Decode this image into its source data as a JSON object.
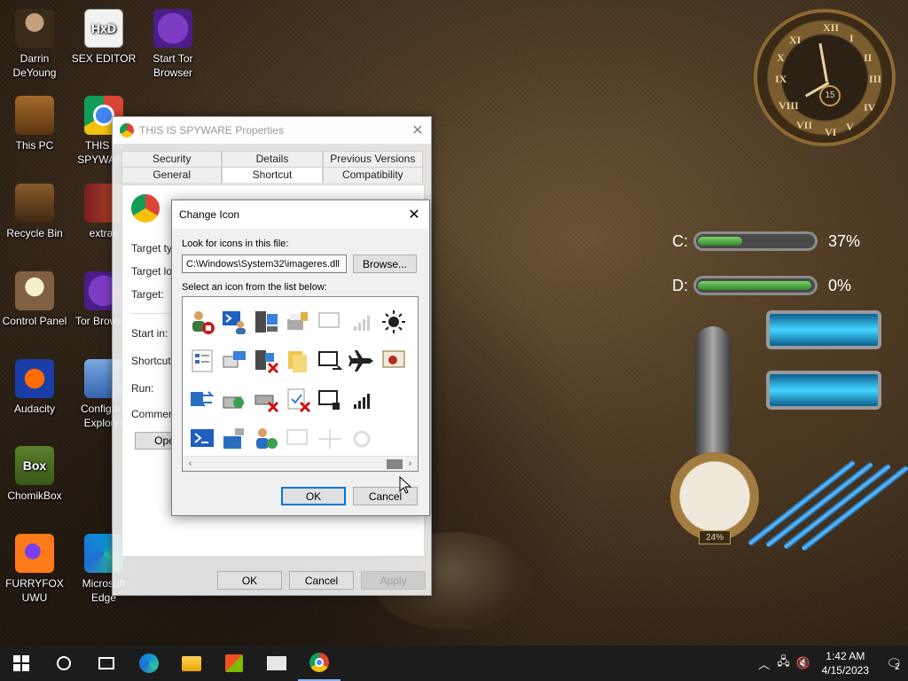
{
  "desktop": {
    "icons": [
      {
        "label": "Darrin DeYoung",
        "icon": "person-portrait-icon"
      },
      {
        "label": "SEX EDITOR",
        "icon": "hex-editor-icon"
      },
      {
        "label": "Start Tor Browser",
        "icon": "tor-browser-icon"
      },
      {
        "label": "This PC",
        "icon": "computer-icon"
      },
      {
        "label": "THIS IS SPYWARE",
        "icon": "chrome-icon"
      },
      {
        "label": "Recycle Bin",
        "icon": "recycle-bin-icon"
      },
      {
        "label": "extras",
        "icon": "book-icon"
      },
      {
        "label": "Control Panel",
        "icon": "lightbulb-icon"
      },
      {
        "label": "Tor Browser",
        "icon": "tor-browser-icon"
      },
      {
        "label": "Audacity",
        "icon": "audacity-icon"
      },
      {
        "label": "Configure Explorer",
        "icon": "shield-icon"
      },
      {
        "label": "ChomikBox",
        "icon": "chomikbox-icon"
      },
      {
        "label": "FURRYFOX UWU",
        "icon": "firefox-icon"
      },
      {
        "label": "Microsoft Edge",
        "icon": "edge-icon"
      }
    ]
  },
  "properties_window": {
    "title": "THIS IS SPYWARE Properties",
    "tabs_row1": [
      "Security",
      "Details",
      "Previous Versions"
    ],
    "tabs_row2": [
      "General",
      "Shortcut",
      "Compatibility"
    ],
    "active_tab": "Shortcut",
    "fields": [
      "Target type:",
      "Target location:",
      "Target:",
      "Start in:",
      "Shortcut key:",
      "Run:",
      "Comment:"
    ],
    "open_label": "Open File Location",
    "ok_label": "OK",
    "cancel_label": "Cancel",
    "apply_label": "Apply"
  },
  "change_icon_dialog": {
    "title": "Change Icon",
    "look_label": "Look for icons in this file:",
    "path_value": "C:\\Windows\\System32\\imageres.dll",
    "browse_label": "Browse...",
    "select_label": "Select an icon from the list below:",
    "ok_label": "OK",
    "cancel_label": "Cancel",
    "icons": [
      "users-stop-icon",
      "powershell-user-icon",
      "server-network-icon",
      "printer-lock-icon",
      "monitor-outline-icon",
      "signal-faded-icon",
      "brightness-icon",
      "form-list-icon",
      "pc-network-icon",
      "server-error-icon",
      "folders-icon",
      "monitor-arrow-icon",
      "airplane-icon",
      "certificate-icon",
      "monitor-network-icon",
      "device-sync-icon",
      "drive-error-icon",
      "check-error-icon",
      "monitor-lock-icon",
      "signal-bars-icon",
      "blank-icon",
      "powershell-icon",
      "pc-arrow-icon",
      "users-sync-icon",
      "monitor-faded-icon",
      "network-faded-icon",
      "settings-faded-icon",
      "blank-icon"
    ]
  },
  "gadgets": {
    "clock_sub": "15",
    "drives": [
      {
        "letter": "C:",
        "percent": "37%",
        "fill": 0.37
      },
      {
        "letter": "D:",
        "percent": "0%",
        "fill": 0.0
      }
    ],
    "gauge_value": "24%"
  },
  "taskbar": {
    "time": "1:42 AM",
    "date": "4/15/2023",
    "notification_count": "2"
  }
}
